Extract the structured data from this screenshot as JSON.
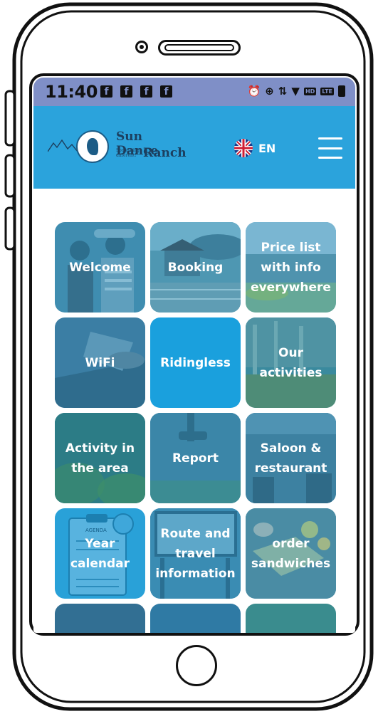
{
  "status_bar": {
    "time": "11:40",
    "notification_icons": [
      "f",
      "f",
      "f",
      "f"
    ],
    "system_icons": [
      "alarm-icon",
      "data-saver-icon",
      "data-arrows-icon",
      "wifi-icon",
      "hd-icon",
      "lte-signal-icon",
      "battery-icon"
    ],
    "hd_label": "HD",
    "lte_label": "LTE"
  },
  "header": {
    "logo_title": "Sun Dance",
    "logo_subtitle": "Ranch",
    "logo_tagline": "Something different!",
    "language": "EN",
    "accent_color": "#2ba3dc"
  },
  "tiles": [
    {
      "label": "Welcome"
    },
    {
      "label": "Booking"
    },
    {
      "label": "Price list with info everywhere"
    },
    {
      "label": "WiFi"
    },
    {
      "label": "Ridingless"
    },
    {
      "label": "Our activities"
    },
    {
      "label": "Activity in the area"
    },
    {
      "label": "Report"
    },
    {
      "label": "Saloon & restaurant"
    },
    {
      "label": "Year calendar"
    },
    {
      "label": "Route and travel information"
    },
    {
      "label": "order sandwiches"
    },
    {
      "label": ""
    },
    {
      "label": ""
    },
    {
      "label": ""
    }
  ],
  "calendar_decoration": "AGENDA"
}
